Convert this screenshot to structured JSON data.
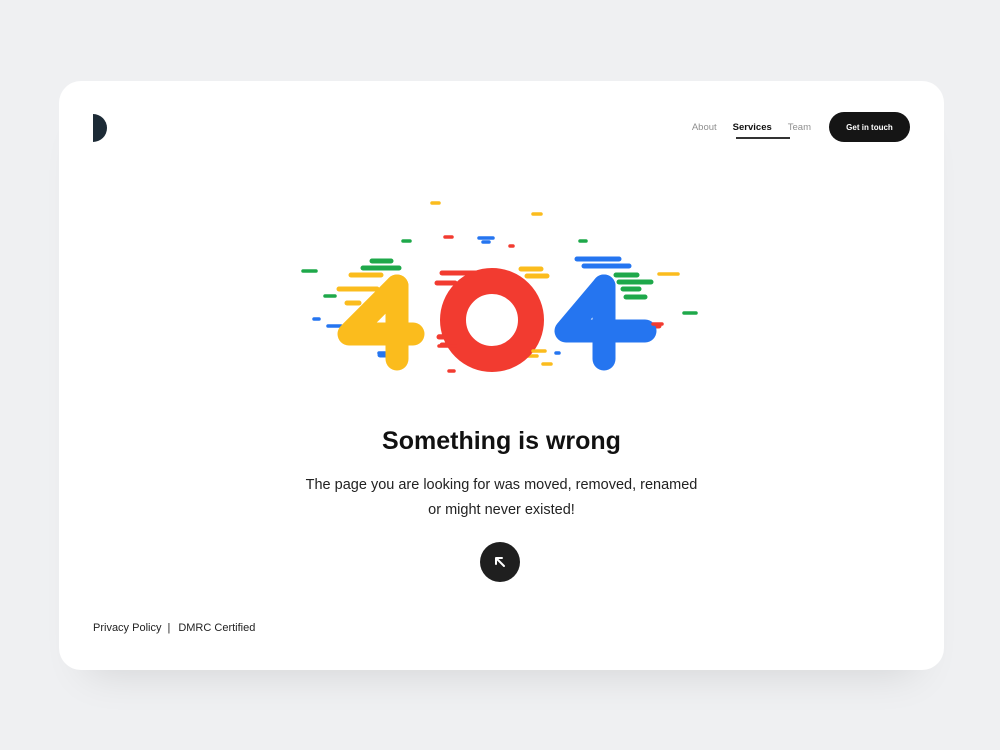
{
  "brand": {
    "logo_icon": "half-circle-logo",
    "logo_color": "#1d2b36"
  },
  "nav": {
    "items": [
      {
        "label": "About",
        "active": false
      },
      {
        "label": "Services",
        "active": true
      },
      {
        "label": "Team",
        "active": false
      }
    ],
    "cta_label": "Get in touch"
  },
  "illustration": {
    "digits": [
      "4",
      "0",
      "4"
    ],
    "colors": {
      "yellow": "#fbbc1d",
      "red": "#f23b30",
      "blue": "#2575f0",
      "green": "#1ea84a"
    }
  },
  "main": {
    "title": "Something is wrong",
    "description_line1": "The page you are looking for was moved, removed, renamed",
    "description_line2": "or might never existed!",
    "back_icon": "arrow-up-left-icon"
  },
  "footer": {
    "privacy": "Privacy Policy",
    "separator": "|",
    "certified": "DMRC Certified"
  }
}
